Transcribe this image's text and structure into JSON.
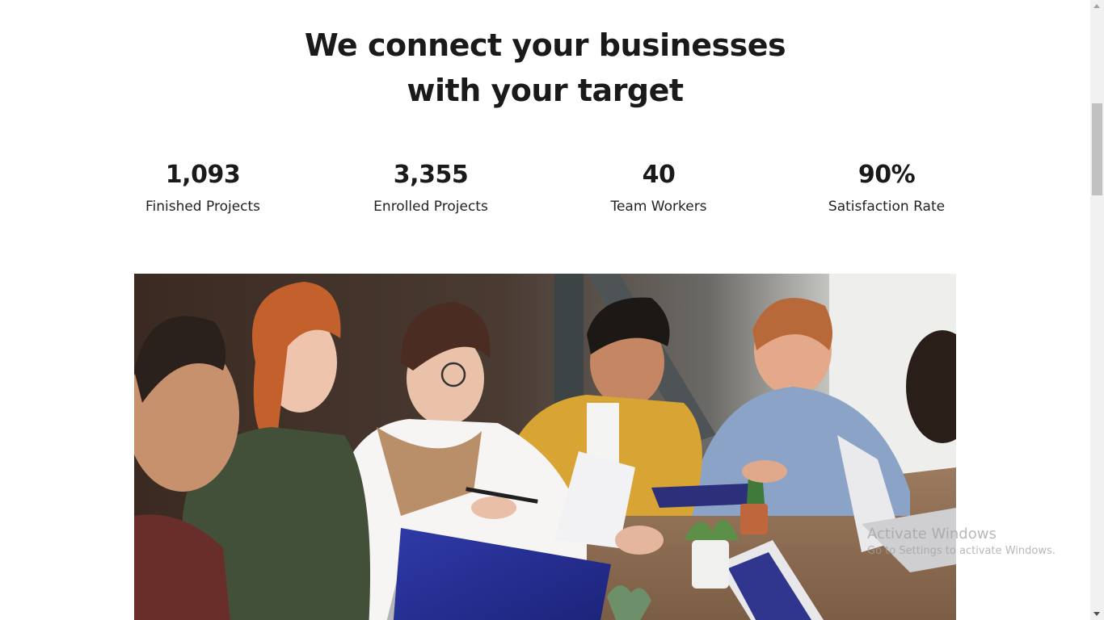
{
  "section": {
    "heading_line1": "We connect your businesses",
    "heading_line2": "with your target"
  },
  "stats": [
    {
      "value": "1,093",
      "label": "Finished Projects"
    },
    {
      "value": "3,355",
      "label": "Enrolled Projects"
    },
    {
      "value": "40",
      "label": "Team Workers"
    },
    {
      "value": "90%",
      "label": "Satisfaction Rate"
    }
  ],
  "watermark": {
    "title": "Activate Windows",
    "subtitle": "Go to Settings to activate Windows."
  },
  "colors": {
    "text": "#1a1a1a",
    "background": "#ffffff",
    "scrollbar_track": "#f1f1f1",
    "scrollbar_thumb": "#c1c1c1"
  }
}
